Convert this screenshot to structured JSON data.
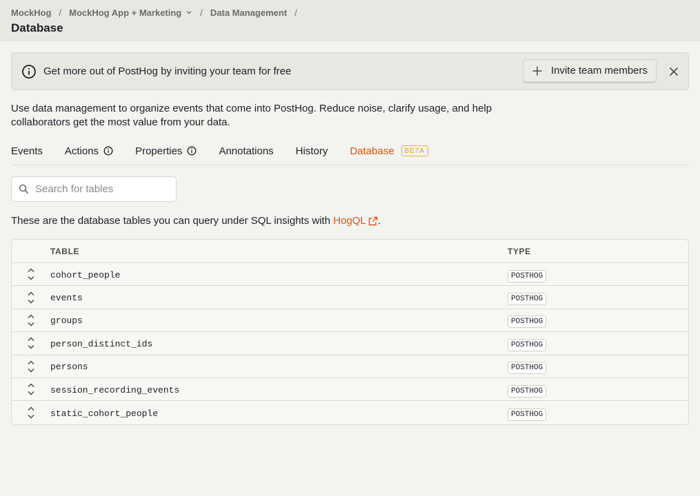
{
  "breadcrumbs": {
    "org": "MockHog",
    "project": "MockHog App + Marketing",
    "section": "Data Management",
    "separator": "/"
  },
  "page_title": "Database",
  "banner": {
    "message": "Get more out of PostHog by inviting your team for free",
    "invite_label": "Invite team members",
    "icons": [
      "info-icon",
      "plus-icon",
      "close-icon"
    ]
  },
  "description": "Use data management to organize events that come into PostHog. Reduce noise, clarify usage, and help collaborators get the most value from your data.",
  "tabs": [
    {
      "label": "Events",
      "info": false,
      "active": false
    },
    {
      "label": "Actions",
      "info": true,
      "active": false
    },
    {
      "label": "Properties",
      "info": true,
      "active": false
    },
    {
      "label": "Annotations",
      "info": false,
      "active": false
    },
    {
      "label": "History",
      "info": false,
      "active": false
    },
    {
      "label": "Database",
      "info": false,
      "active": true,
      "badge": "BETA"
    }
  ],
  "search": {
    "placeholder": "Search for tables",
    "value": ""
  },
  "note": {
    "prefix": "These are the database tables you can query under SQL insights with ",
    "link": "HogQL",
    "suffix": "."
  },
  "table": {
    "headers": {
      "name": "TABLE",
      "type": "TYPE"
    },
    "rows": [
      {
        "name": "cohort_people",
        "type": "POSTHOG"
      },
      {
        "name": "events",
        "type": "POSTHOG"
      },
      {
        "name": "groups",
        "type": "POSTHOG"
      },
      {
        "name": "person_distinct_ids",
        "type": "POSTHOG"
      },
      {
        "name": "persons",
        "type": "POSTHOG"
      },
      {
        "name": "session_recording_events",
        "type": "POSTHOG"
      },
      {
        "name": "static_cohort_people",
        "type": "POSTHOG"
      }
    ]
  },
  "colors": {
    "accent": "#e2530c",
    "beta": "#e2a21b",
    "background": "#f3f3ef"
  }
}
